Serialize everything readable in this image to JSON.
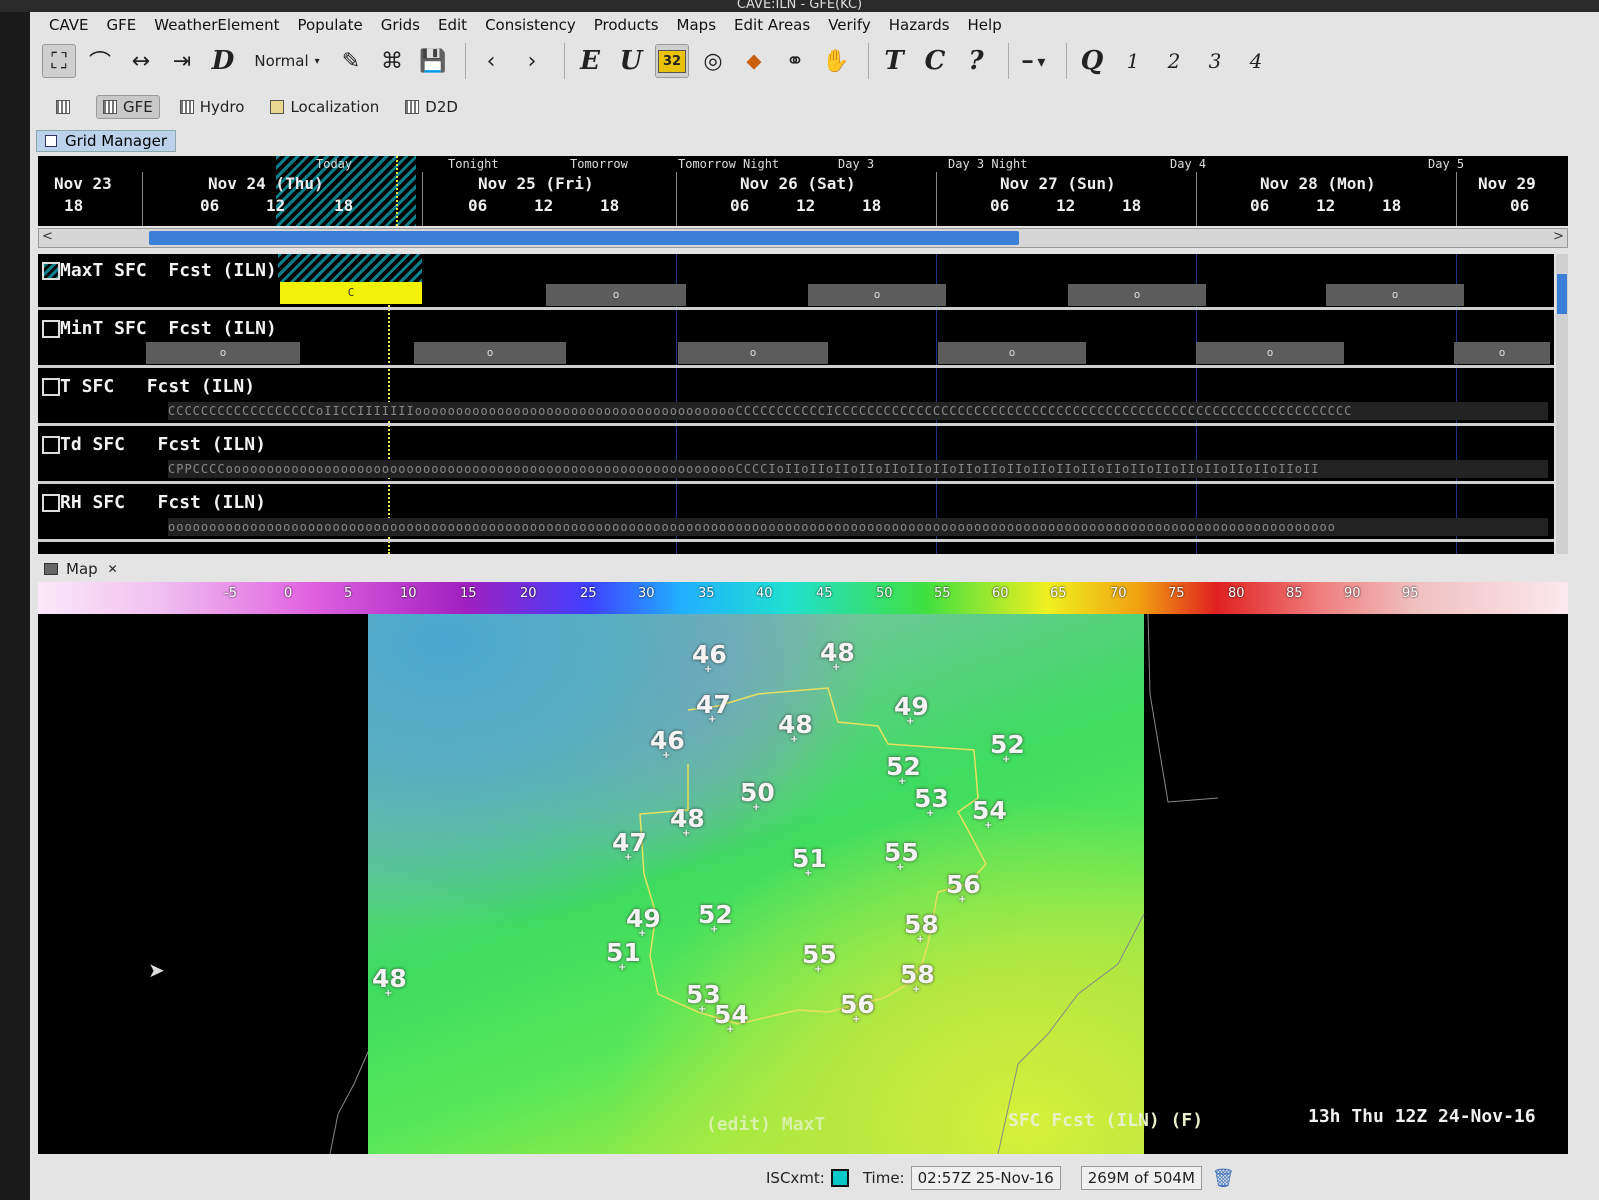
{
  "window_title": "CAVE:ILN - GFE(KC)",
  "menubar": [
    "CAVE",
    "GFE",
    "WeatherElement",
    "Populate",
    "Grids",
    "Edit",
    "Consistency",
    "Products",
    "Maps",
    "Edit Areas",
    "Verify",
    "Hazards",
    "Help"
  ],
  "toolbar": {
    "mode_label": "Normal",
    "d_label": "D",
    "e_label": "E",
    "u_label": "U",
    "badge_label": "32",
    "t_label": "T",
    "c_label": "C",
    "q_label": "?",
    "bigq_label": "Q",
    "nums": [
      "1",
      "2",
      "3",
      "4"
    ]
  },
  "perspectives": {
    "gfe": "GFE",
    "hydro": "Hydro",
    "localization": "Localization",
    "d2d": "D2D"
  },
  "grid_manager": {
    "tab_label": "Grid Manager",
    "periods": [
      "Today",
      "Tonight",
      "Tomorrow",
      "Tomorrow Night",
      "Day 3",
      "Day 3 Night",
      "Day 4",
      "Day 5"
    ],
    "days": [
      "Nov 23",
      "Nov 24 (Thu)",
      "Nov 25 (Fri)",
      "Nov 26 (Sat)",
      "Nov 27 (Sun)",
      "Nov 28 (Mon)",
      "Nov 29"
    ],
    "hours": [
      "18",
      "06",
      "12",
      "18",
      "06",
      "12",
      "18",
      "06",
      "12",
      "18",
      "06",
      "12",
      "18",
      "06",
      "12",
      "18",
      "06"
    ],
    "tracks": [
      {
        "label": "MaxT SFC  Fcst (ILN)",
        "boxes": [
          "C",
          "o",
          "o",
          "o",
          "o"
        ]
      },
      {
        "label": "MinT SFC  Fcst (ILN)",
        "boxes": [
          "o",
          "o",
          "o",
          "o",
          "o",
          "o"
        ]
      },
      {
        "label": "T SFC   Fcst (ILN)",
        "strip": "CCCCCCCCCCCCCCCCCCoIICCIIIIIIIoooooooooooooooooooooooooooooooooooooooCCCCCCCCCCCICCCCCCCCCCCCCCCCCCCCCCCCCCCCCCCCCCCCCCCCCCCCCCCCCCCCCCCCCCCCCCC"
      },
      {
        "label": "Td SFC   Fcst (ILN)",
        "strip": "CPPCCCCooooooooooooooooooooooooooooooooooooooooooooooooooooooooooooooCCCCIoIIoIIoIIoIIoIIoIIoIIoIIoIIoIIoIIoIIoIIoIIoIIoIIoIIoIIoIIoIIoIIoII"
      },
      {
        "label": "RH SFC   Fcst (ILN)",
        "strip": "oooooooooooooooooooooooooooooooooooooooooooooooooooooooooooooooooooooooooooooooooooooooooooooooooooooooooooooooooooooooooooooooooooooooooooooo"
      }
    ]
  },
  "map": {
    "tab_label": "Map",
    "colorbar_ticks": [
      "-5",
      "0",
      "5",
      "10",
      "15",
      "20",
      "25",
      "30",
      "35",
      "40",
      "45",
      "50",
      "55",
      "60",
      "65",
      "70",
      "75",
      "80",
      "85",
      "90",
      "95"
    ],
    "points": [
      "46",
      "48",
      "47",
      "48",
      "49",
      "46",
      "52",
      "52",
      "50",
      "53",
      "54",
      "47",
      "48",
      "51",
      "55",
      "56",
      "49",
      "52",
      "58",
      "51",
      "55",
      "58",
      "48",
      "53",
      "54",
      "56"
    ],
    "overlay_edit": "(edit) MaxT",
    "overlay_source": "SFC Fcst (ILN) (F)",
    "overlay_time": "13h Thu 12Z 24-Nov-16"
  },
  "status": {
    "isc_label": "ISCxmt:",
    "time_label": "Time:",
    "time_value": "02:57Z 25-Nov-16",
    "memory": "269M of 504M"
  },
  "colors": {
    "hatch": "#0b7f8a",
    "yellow": "#f2f20a",
    "scroll_blue": "#3b7fd8"
  }
}
